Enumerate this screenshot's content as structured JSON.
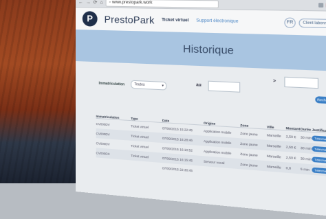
{
  "browser": {
    "url": "www.prestopark.work"
  },
  "header": {
    "brand": "PrestoPark",
    "logo_letter": "P",
    "nav": [
      "Ticket virtuel",
      "Support électronique"
    ],
    "lang": "FR",
    "account": "Client labonne"
  },
  "page": {
    "title": "Historique"
  },
  "filters": {
    "immat_label": "Immatriculation",
    "immat_value": "Toutes",
    "from_label": "au",
    "to_label": ">",
    "search_button": "Rechercher"
  },
  "table": {
    "headers": [
      "Immatriculation",
      "Type",
      "Date",
      "Origine",
      "Zone",
      "Ville",
      "Montant",
      "Durée",
      "Justificatif"
    ],
    "rows": [
      [
        "CV000DV",
        "Ticket virtuel",
        "07/09/2015 15:22:45",
        "Application mobile",
        "Zone jaune",
        "Marseille",
        "2,50 €",
        "30 min",
        "Télécharger"
      ],
      [
        "CV000DV",
        "Ticket virtuel",
        "07/09/2015 16:28:46",
        "Application mobile",
        "Zone jaune",
        "Marseille",
        "2,50 €",
        "30 min",
        "Télécharger"
      ],
      [
        "CV000DV",
        "Ticket virtuel",
        "07/09/2015 16:10:52",
        "Application mobile",
        "Zone jaune",
        "Marseille",
        "2,50 €",
        "30 min",
        "Télécharger"
      ],
      [
        "CV000DX",
        "Ticket virtuel",
        "07/09/2015 16:15:45",
        "Serveur vocal",
        "Zone jaune",
        "Marseille",
        "0,8",
        "5 min",
        "Télécharger"
      ],
      [
        "",
        "",
        "07/09/2015 22:30:45",
        "",
        "",
        "",
        "",
        "",
        ""
      ]
    ]
  }
}
